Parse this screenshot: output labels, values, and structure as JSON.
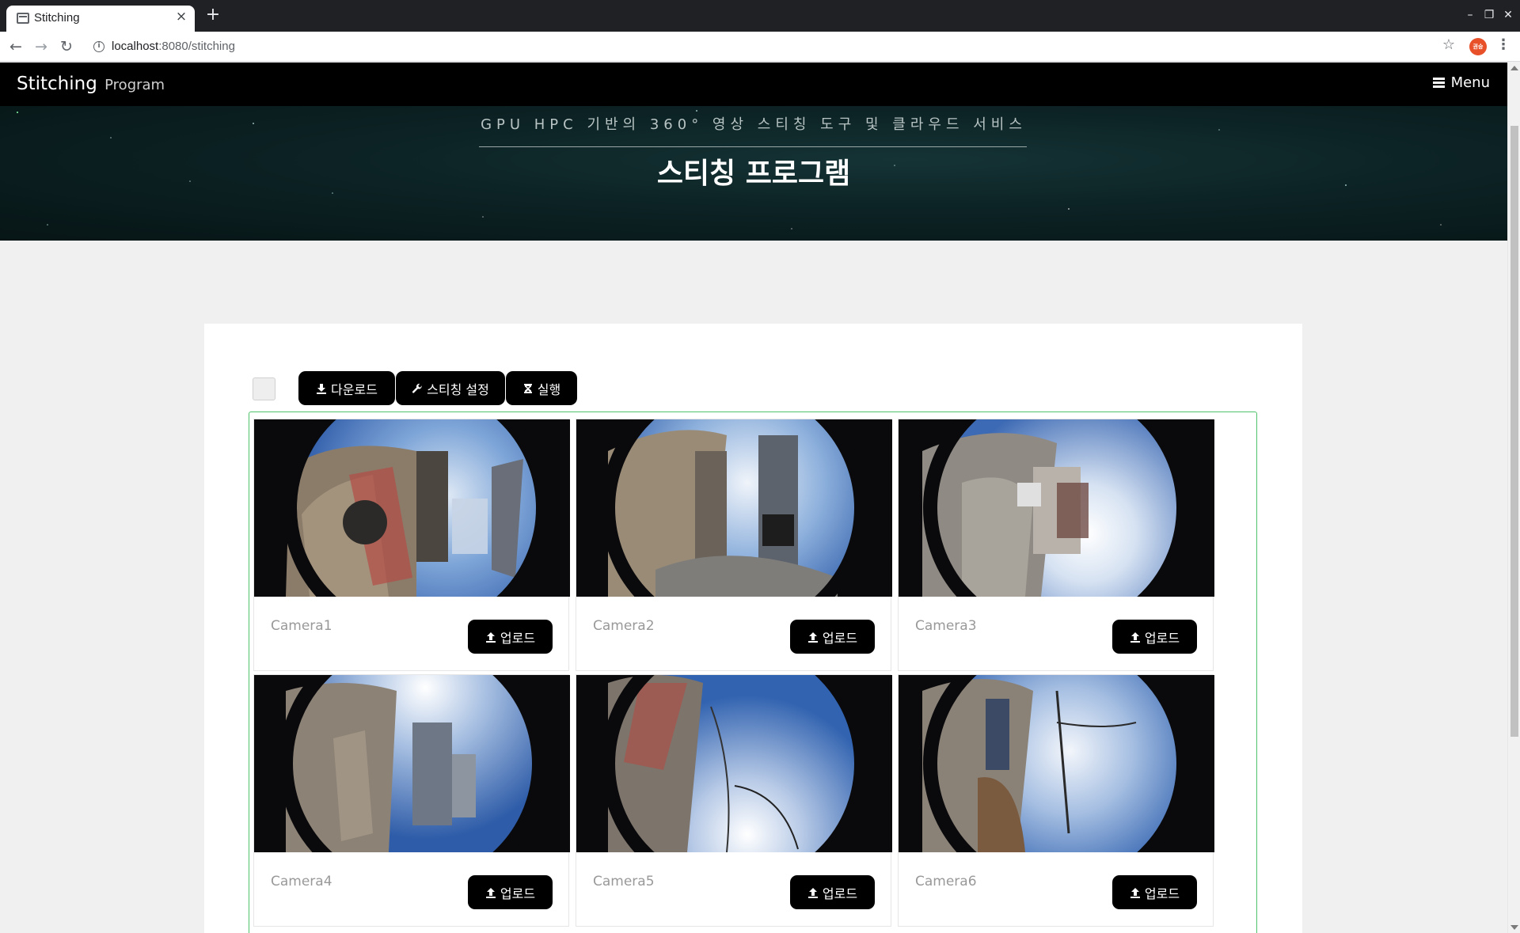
{
  "browser": {
    "tab_title": "Stitching",
    "url_host": "localhost",
    "url_path": ":8080/stitching",
    "avatar_text": "권승"
  },
  "navbar": {
    "brand_main": "Stitching",
    "brand_sub": "Program",
    "menu_label": "Menu"
  },
  "hero": {
    "subheading": "GPU HPC 기반의 360° 영상 스티칭 도구 및 클라우드 서비스",
    "heading": "스티칭 프로그램"
  },
  "actions": {
    "download_label": "다운로드",
    "settings_label": "스티칭 설정",
    "run_label": "실행"
  },
  "cameras": [
    {
      "label": "Camera1",
      "upload_label": "업로드"
    },
    {
      "label": "Camera2",
      "upload_label": "업로드"
    },
    {
      "label": "Camera3",
      "upload_label": "업로드"
    },
    {
      "label": "Camera4",
      "upload_label": "업로드"
    },
    {
      "label": "Camera5",
      "upload_label": "업로드"
    },
    {
      "label": "Camera6",
      "upload_label": "업로드"
    }
  ],
  "colors": {
    "navbar_bg": "#000000",
    "button_bg": "#000000",
    "gallery_border": "#4fc36b",
    "hero_bg": "#0c2224"
  },
  "icons": {
    "download": "download-icon",
    "settings": "wrench-icon",
    "run": "hourglass-icon",
    "upload": "upload-icon",
    "menu": "hamburger-icon"
  }
}
